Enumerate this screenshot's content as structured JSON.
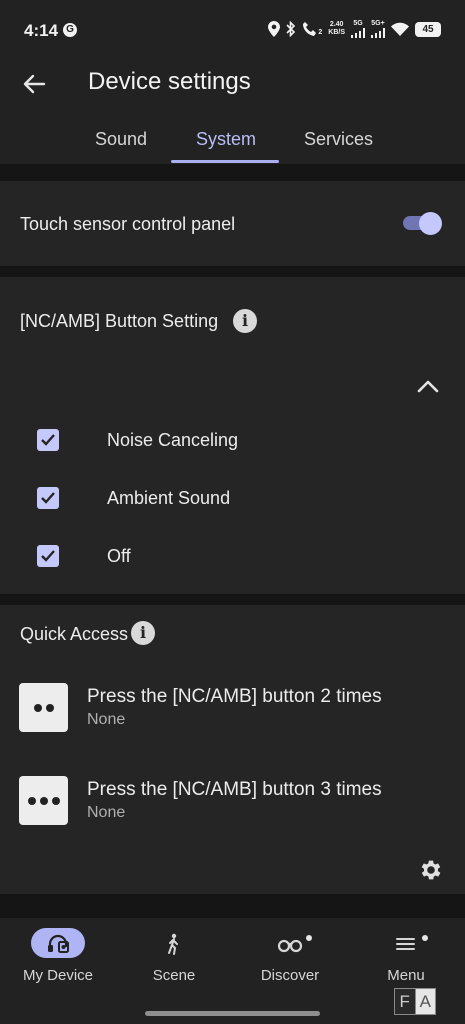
{
  "status_bar": {
    "time": "4:14",
    "app_icon_glyph": "G",
    "net_speed_value": "2.40",
    "net_speed_unit": "KB/S",
    "sim1_label": "5G",
    "sim2_label": "5G+",
    "call_sim_label": "2",
    "battery_level": "45",
    "icons": [
      "location-icon",
      "bluetooth-icon",
      "wifi-call-icon",
      "signal-icon",
      "wifi-icon",
      "battery-icon"
    ]
  },
  "header": {
    "title": "Device settings",
    "back_icon": "arrow-left-icon"
  },
  "tabs": [
    {
      "label": "Sound",
      "active": false
    },
    {
      "label": "System",
      "active": true
    },
    {
      "label": "Services",
      "active": false
    }
  ],
  "touch_sensor": {
    "label": "Touch sensor control panel",
    "enabled": true
  },
  "nc_amb": {
    "title": "[NC/AMB] Button Setting",
    "info_icon": "info-icon",
    "options": [
      {
        "label": "Noise Canceling",
        "checked": true
      },
      {
        "label": "Ambient Sound",
        "checked": true
      },
      {
        "label": "Off",
        "checked": true
      }
    ]
  },
  "quick_access": {
    "title": "Quick Access",
    "items": [
      {
        "title": "Press the [NC/AMB] button 2 times",
        "value": "None",
        "dots": 2
      },
      {
        "title": "Press the [NC/AMB] button 3 times",
        "value": "None",
        "dots": 3
      }
    ]
  },
  "bottom_nav": [
    {
      "label": "My Device",
      "icon": "headphones-icon",
      "active": true
    },
    {
      "label": "Scene",
      "icon": "walking-person-icon",
      "active": false
    },
    {
      "label": "Discover",
      "icon": "binoculars-icon",
      "active": false,
      "badge": true
    },
    {
      "label": "Menu",
      "icon": "hamburger-menu-icon",
      "active": false,
      "badge": true
    }
  ],
  "overlay": {
    "left": "F",
    "right": "A"
  },
  "colors": {
    "accent": "#aeb4f4",
    "background": "#151515",
    "card": "#252525",
    "bar": "#222222"
  }
}
